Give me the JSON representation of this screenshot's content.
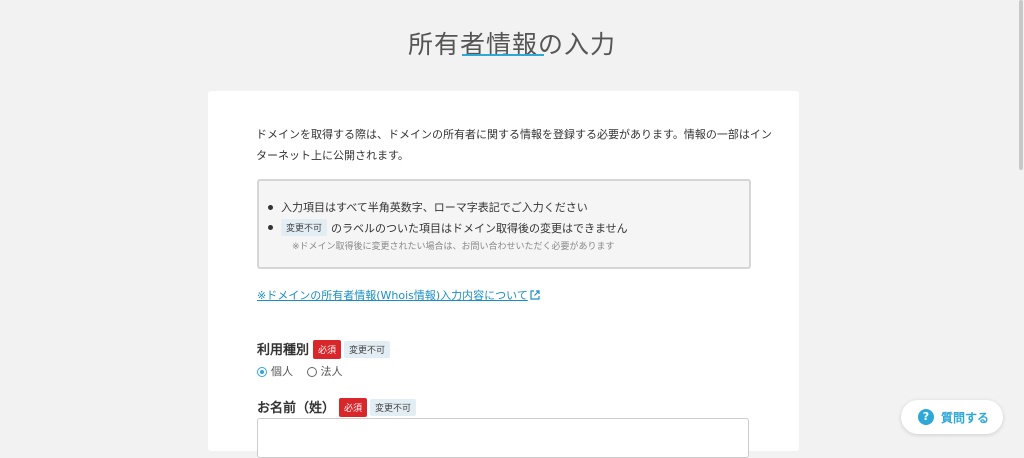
{
  "page": {
    "title": "所有者情報の入力"
  },
  "intro": {
    "text": "ドメインを取得する際は、ドメインの所有者に関する情報を登録する必要があります。情報の一部はインターネット上に公開されます。"
  },
  "notes": {
    "item1": "入力項目はすべて半角英数字、ローマ字表記でご入力ください",
    "item2_tag": "変更不可",
    "item2_text": "のラベルのついた項目はドメイン取得後の変更はできません",
    "item2_sub": "※ドメイン取得後に変更されたい場合は、お問い合わせいただく必要があります"
  },
  "whois_link": {
    "label": "※ドメインの所有者情報(Whois情報)入力内容について"
  },
  "usage_type": {
    "label": "利用種別",
    "required_tag": "必須",
    "unchangeable_tag": "変更不可",
    "options": [
      "個人",
      "法人"
    ],
    "selected": "個人"
  },
  "last_name": {
    "label": "お名前（姓）",
    "required_tag": "必須",
    "unchangeable_tag": "変更不可",
    "value": "",
    "placeholder": ""
  },
  "help": {
    "icon": "?",
    "label": "質問する"
  },
  "colors": {
    "accent": "#2ea8d6",
    "required_red": "#d8262b",
    "link": "#1a8fc4"
  }
}
